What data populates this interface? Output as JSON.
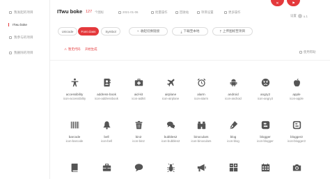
{
  "sidebar": {
    "items": [
      {
        "label": "我发起的项目"
      },
      {
        "label": "ITwu boke"
      },
      {
        "label": "我参与的项目"
      },
      {
        "label": "我删除的项目"
      }
    ]
  },
  "header": {
    "title": "ITwu boke",
    "count": "127",
    "count_unit": "个图标",
    "date": "2021-01-06",
    "meta": [
      {
        "label": "批量操作"
      },
      {
        "label": "回收站"
      },
      {
        "label": "项目设置"
      },
      {
        "label": "更多操作"
      }
    ],
    "user": {
      "label": "设置",
      "name": "u.1"
    },
    "help_label": "使用帮助"
  },
  "tabs": [
    {
      "label": "Unicode"
    },
    {
      "label": "Font class"
    },
    {
      "label": "Symbol"
    }
  ],
  "actions": [
    {
      "label": "收起切换链接"
    },
    {
      "label": "下载至本地"
    },
    {
      "label": "上传图标至项目"
    }
  ],
  "links": [
    {
      "label": "暂无代码"
    },
    {
      "label": "开始生成"
    }
  ],
  "colors": {
    "accent": "#e4393c",
    "icon": "#555555"
  },
  "icons_row1": [
    {
      "name": "accessibility",
      "cls": "icon-accessibility",
      "icon": "accessibility-icon"
    },
    {
      "name": "address-book",
      "cls": "icon-addressbook",
      "icon": "address-book-icon"
    },
    {
      "name": "aid-kit",
      "cls": "icon-aidkit",
      "icon": "aid-kit-icon"
    },
    {
      "name": "airplane",
      "cls": "icon-airplane",
      "icon": "airplane-icon"
    },
    {
      "name": "alarm",
      "cls": "icon-alarm",
      "icon": "alarm-icon"
    },
    {
      "name": "android",
      "cls": "icon-android",
      "icon": "android-icon"
    },
    {
      "name": "angry2",
      "cls": "icon-angry2",
      "icon": "angry-face-icon"
    },
    {
      "name": "apple",
      "cls": "icon-apple",
      "icon": "apple-icon"
    }
  ],
  "icons_row2": [
    {
      "name": "barcode",
      "cls": "icon-barcode",
      "icon": "barcode-icon"
    },
    {
      "name": "bell",
      "cls": "icon-bell",
      "icon": "bell-icon"
    },
    {
      "name": "bin2",
      "cls": "icon-bin2",
      "icon": "trash-icon"
    },
    {
      "name": "bubbles2",
      "cls": "icon-bubbles2",
      "icon": "chat-bubbles-icon"
    },
    {
      "name": "binoculars",
      "cls": "icon-binoculars",
      "icon": "binoculars-icon"
    },
    {
      "name": "blog",
      "cls": "icon-blog",
      "icon": "blog-icon"
    },
    {
      "name": "blogger",
      "cls": "icon-blogger",
      "icon": "blogger-icon"
    },
    {
      "name": "blogger2",
      "cls": "icon-blogger2",
      "icon": "blogger-square-icon"
    }
  ],
  "icons_row3": [
    {
      "icon": "book-icon"
    },
    {
      "icon": "briefcase-icon"
    },
    {
      "icon": "speech-bubble-icon"
    },
    {
      "icon": "bug-icon"
    },
    {
      "icon": "bullhorn-icon"
    },
    {
      "icon": "calculator-icon"
    },
    {
      "icon": "calendar-icon"
    },
    {
      "icon": "camera-icon"
    }
  ]
}
